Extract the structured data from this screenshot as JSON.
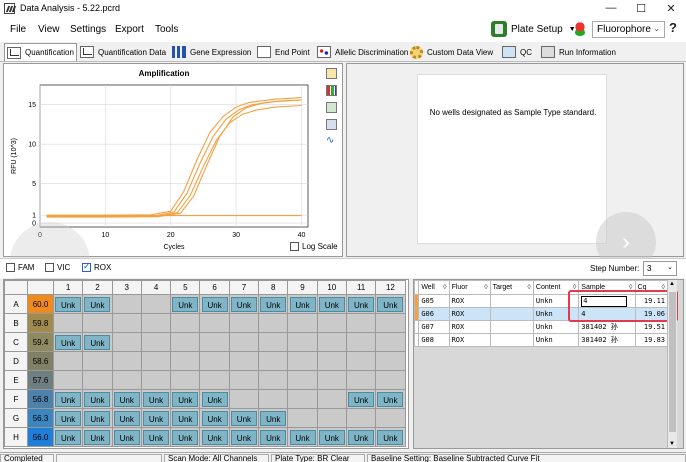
{
  "window": {
    "title": "Data Analysis - 5.22.pcrd"
  },
  "menu": {
    "items": [
      "File",
      "View",
      "Settings",
      "Export",
      "Tools"
    ],
    "plate_setup_label": "Plate Setup",
    "fluorophore_value": "Fluorophore",
    "help_label": "?"
  },
  "tabs": [
    {
      "label": "Quantification",
      "icon": "quantification-chart-icon",
      "active": true
    },
    {
      "label": "Quantification Data",
      "icon": "quantification-data-icon"
    },
    {
      "label": "Gene Expression",
      "icon": "gene-expression-bars-icon"
    },
    {
      "label": "End Point",
      "icon": "end-point-icon"
    },
    {
      "label": "Allelic Discrimination",
      "icon": "allelic-scatter-icon"
    },
    {
      "label": "Custom Data View",
      "icon": "custom-gear-icon"
    },
    {
      "label": "QC",
      "icon": "qc-icon"
    },
    {
      "label": "Run Information",
      "icon": "run-info-icon"
    }
  ],
  "chart": {
    "title": "Amplification",
    "log_scale_label": "Log Scale",
    "std_message": "No wells designated as Sample Type standard."
  },
  "chart_data": {
    "type": "line",
    "title": "Amplification",
    "xlabel": "Cycles",
    "ylabel": "RFU (10^3)",
    "xlim": [
      0,
      41
    ],
    "ylim": [
      -0.5,
      17.5
    ],
    "x_ticks": [
      0,
      10,
      20,
      30,
      40
    ],
    "y_ticks": [
      0,
      1,
      5,
      10,
      15
    ],
    "grid": true,
    "color": "#f5a040",
    "series": [
      {
        "values": [
          [
            1,
            1
          ],
          [
            10,
            1
          ],
          [
            17,
            1.05
          ],
          [
            20,
            1.5
          ],
          [
            22,
            4
          ],
          [
            24,
            8
          ],
          [
            26,
            11.5
          ],
          [
            28,
            13.5
          ],
          [
            30,
            14.7
          ],
          [
            32,
            15.3
          ],
          [
            36,
            15.7
          ],
          [
            40,
            15.9
          ]
        ]
      },
      {
        "values": [
          [
            1,
            0.85
          ],
          [
            10,
            0.85
          ],
          [
            17.5,
            0.9
          ],
          [
            20.5,
            1.4
          ],
          [
            22.5,
            3.8
          ],
          [
            24.5,
            7.6
          ],
          [
            26.5,
            11
          ],
          [
            28.5,
            13.2
          ],
          [
            30.5,
            14.4
          ],
          [
            32.5,
            15
          ],
          [
            36,
            15.4
          ],
          [
            40,
            15.6
          ]
        ]
      },
      {
        "values": [
          [
            1,
            0.8
          ],
          [
            10,
            0.8
          ],
          [
            18,
            0.85
          ],
          [
            21,
            1.3
          ],
          [
            23,
            3.5
          ],
          [
            25,
            7.2
          ],
          [
            27,
            10.5
          ],
          [
            29,
            12.7
          ],
          [
            31,
            13.8
          ],
          [
            33,
            14.3
          ],
          [
            36,
            14.7
          ],
          [
            40,
            14.9
          ]
        ]
      },
      {
        "values": [
          [
            1,
            0.75
          ],
          [
            10,
            0.75
          ],
          [
            18,
            0.8
          ],
          [
            21.5,
            1.25
          ],
          [
            23.5,
            3.4
          ],
          [
            25.5,
            7.3
          ],
          [
            27.5,
            11
          ],
          [
            29.5,
            13.4
          ],
          [
            31.5,
            14.6
          ],
          [
            34,
            15.2
          ],
          [
            37,
            15.5
          ],
          [
            40,
            15.6
          ]
        ]
      },
      {
        "values": [
          [
            1,
            0.95
          ],
          [
            10,
            0.95
          ],
          [
            20,
            0.95
          ],
          [
            30,
            0.95
          ],
          [
            40,
            0.95
          ]
        ]
      }
    ]
  },
  "dyes": [
    {
      "label": "FAM",
      "checked": false
    },
    {
      "label": "VIC",
      "checked": false
    },
    {
      "label": "ROX",
      "checked": true
    }
  ],
  "step": {
    "label": "Step Number:",
    "value": "3"
  },
  "plate": {
    "columns": [
      "1",
      "2",
      "3",
      "4",
      "5",
      "6",
      "7",
      "8",
      "9",
      "10",
      "11",
      "12"
    ],
    "rows": [
      {
        "label": "A",
        "temp": "60.0",
        "color": "#f08a1c",
        "wells": [
          "Unk",
          "Unk",
          "",
          "",
          "Unk",
          "Unk",
          "Unk",
          "Unk",
          "Unk",
          "Unk",
          "Unk",
          "Unk"
        ]
      },
      {
        "label": "B",
        "temp": "59.8",
        "color": "#a08a50",
        "wells": [
          "",
          "",
          "",
          "",
          "",
          "",
          "",
          "",
          "",
          "",
          "",
          ""
        ]
      },
      {
        "label": "C",
        "temp": "59.4",
        "color": "#8f8a60",
        "wells": [
          "Unk",
          "Unk",
          "",
          "",
          "",
          "",
          "",
          "",
          "",
          "",
          "",
          ""
        ]
      },
      {
        "label": "D",
        "temp": "58.6",
        "color": "#7f8065",
        "wells": [
          "",
          "",
          "",
          "",
          "",
          "",
          "",
          "",
          "",
          "",
          "",
          ""
        ]
      },
      {
        "label": "E",
        "temp": "57.6",
        "color": "#6f7f80",
        "wells": [
          "",
          "",
          "",
          "",
          "",
          "",
          "",
          "",
          "",
          "",
          "",
          ""
        ]
      },
      {
        "label": "F",
        "temp": "56.8",
        "color": "#4f82aa",
        "wells": [
          "Unk",
          "Unk",
          "Unk",
          "Unk",
          "Unk",
          "Unk",
          "",
          "",
          "",
          "",
          "Unk",
          "Unk"
        ]
      },
      {
        "label": "G",
        "temp": "56.3",
        "color": "#3c86c0",
        "wells": [
          "Unk",
          "Unk",
          "Unk",
          "Unk",
          "Unk",
          "Unk",
          "Unk",
          "Unk",
          "",
          "",
          "",
          ""
        ]
      },
      {
        "label": "H",
        "temp": "56.0",
        "color": "#1f7fd8",
        "wells": [
          "Unk",
          "Unk",
          "Unk",
          "Unk",
          "Unk",
          "Unk",
          "Unk",
          "Unk",
          "Unk",
          "Unk",
          "Unk",
          "Unk"
        ]
      }
    ]
  },
  "well_table": {
    "headers": [
      "Well",
      "Fluor",
      "Target",
      "Content",
      "Sample",
      "Cq"
    ],
    "rows": [
      {
        "mark": "#f5a040",
        "well": "G05",
        "fluor": "ROX",
        "target": "",
        "content": "Unkn",
        "sample": "4",
        "cq": "19.11",
        "editing": true
      },
      {
        "mark": "#f5a040",
        "well": "G06",
        "fluor": "ROX",
        "target": "",
        "content": "Unkn",
        "sample": "4",
        "cq": "19.06",
        "selected": true
      },
      {
        "mark": "",
        "well": "G07",
        "fluor": "ROX",
        "target": "",
        "content": "Unkn",
        "sample": "381402 孙",
        "cq": "19.51"
      },
      {
        "mark": "",
        "well": "G08",
        "fluor": "ROX",
        "target": "",
        "content": "Unkn",
        "sample": "381402 孙",
        "cq": "19.83"
      }
    ]
  },
  "status": {
    "items": [
      "Completed",
      "",
      "Scan Mode: All Channels",
      "Plate Type: BR Clear",
      "Baseline Setting: Baseline Subtracted Curve Fit"
    ]
  }
}
